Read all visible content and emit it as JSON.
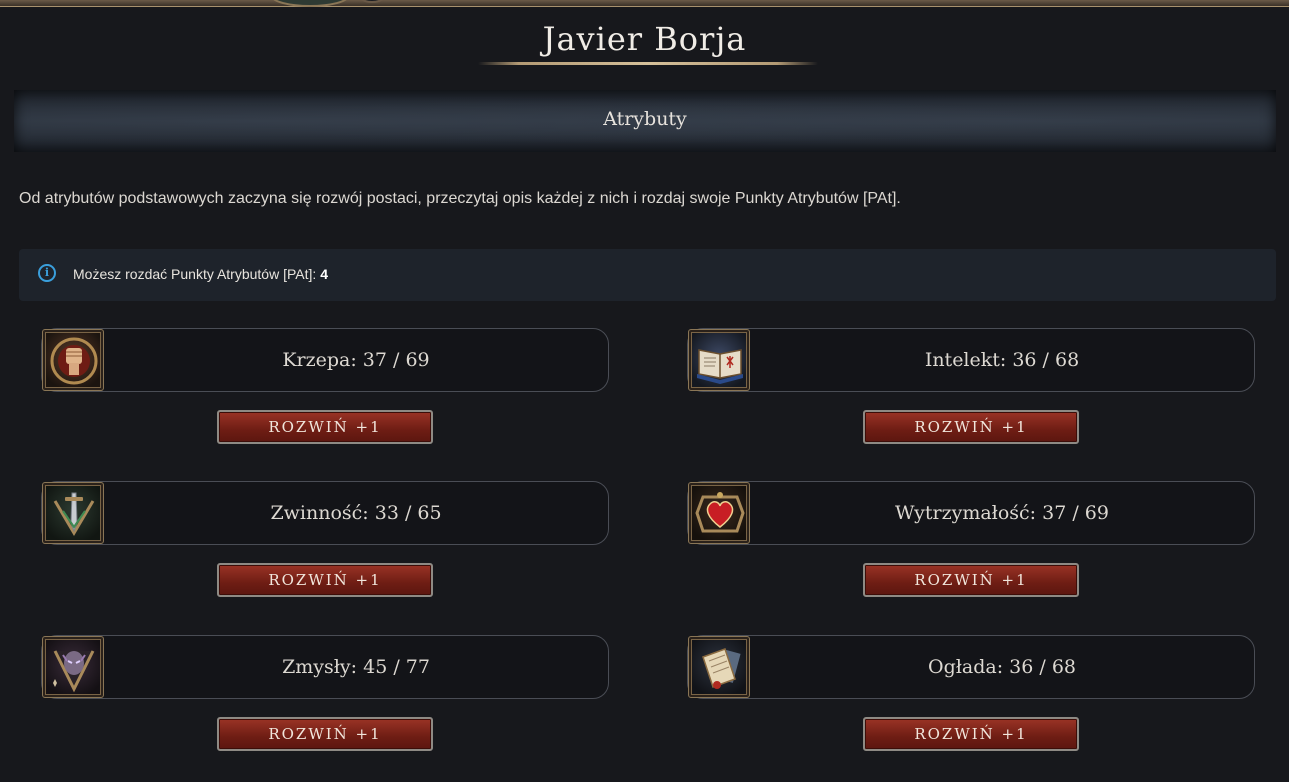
{
  "character": {
    "name": "Javier Borja"
  },
  "section": {
    "title": "Atrybuty"
  },
  "intro_text": "Od atrybutów podstawowych zaczyna się rozwój postaci, przeczytaj opis każdej z nich i rozdaj swoje Punkty Atrybutów [PAt].",
  "info": {
    "icon": "info-icon",
    "label": "Możesz rozdać Punkty Atrybutów [PAt]:",
    "points": "4",
    "accent_color": "#3a9fdc"
  },
  "attributes": [
    {
      "label": "Krzepa: 37 / 69",
      "icon": "fist-icon",
      "button": "ROZWIŃ +1"
    },
    {
      "label": "Intelekt: 36 / 68",
      "icon": "book-icon",
      "button": "ROZWIŃ +1"
    },
    {
      "label": "Zwinność: 33 / 65",
      "icon": "dagger-icon",
      "button": "ROZWIŃ +1"
    },
    {
      "label": "Wytrzymałość: 37 / 69",
      "icon": "heart-icon",
      "button": "ROZWIŃ +1"
    },
    {
      "label": "Zmysły: 45 / 77",
      "icon": "mask-icon",
      "button": "ROZWIŃ +1"
    },
    {
      "label": "Ogłada: 36 / 68",
      "icon": "scroll-icon",
      "button": "ROZWIŃ +1"
    }
  ],
  "colors": {
    "button_red": "#8a2a1e",
    "gold_trim": "#b39a74",
    "background": "#17181c"
  }
}
